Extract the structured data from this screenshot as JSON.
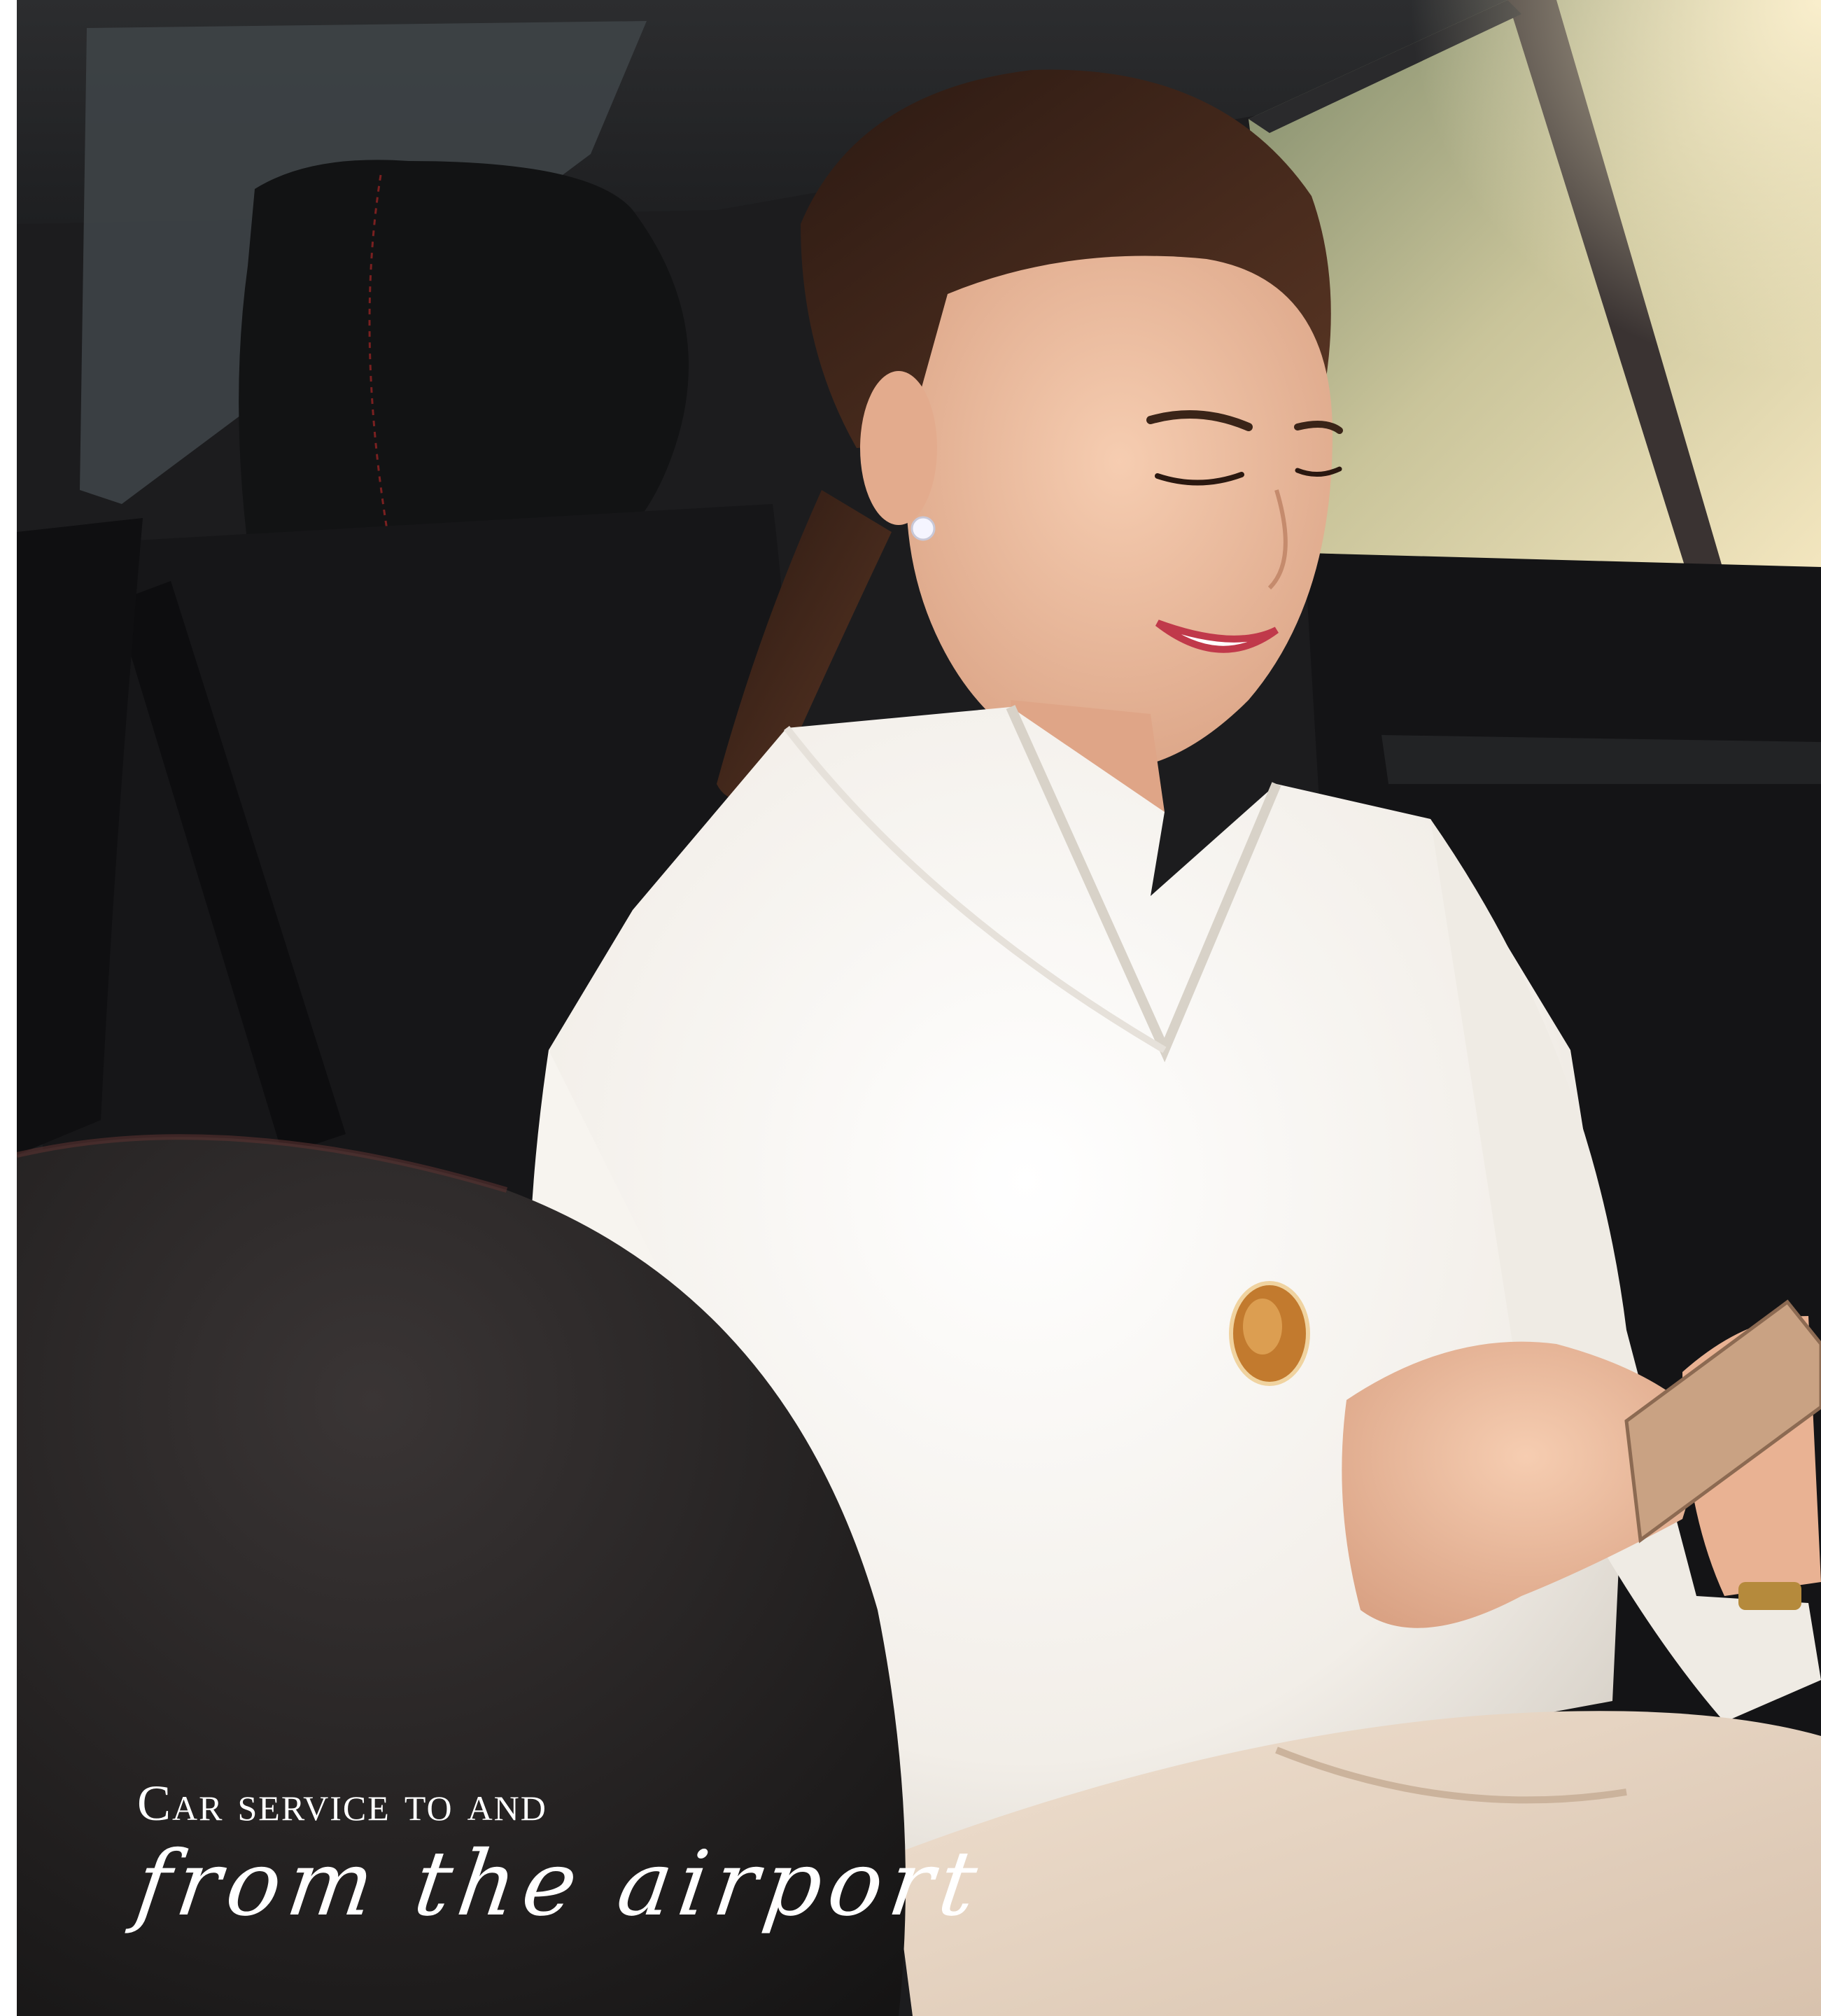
{
  "caption": {
    "line1": "Car service to and",
    "line2": "from the airport"
  },
  "colors": {
    "background": "#ffffff",
    "car_interior": "#1b1b1d",
    "blouse": "#f4f1ec",
    "pants": "#e6d4c2",
    "hair": "#3a2218",
    "skin": "#e9b89b",
    "window_glow": "#f2e6c2",
    "caption_text": "#ffffff"
  }
}
